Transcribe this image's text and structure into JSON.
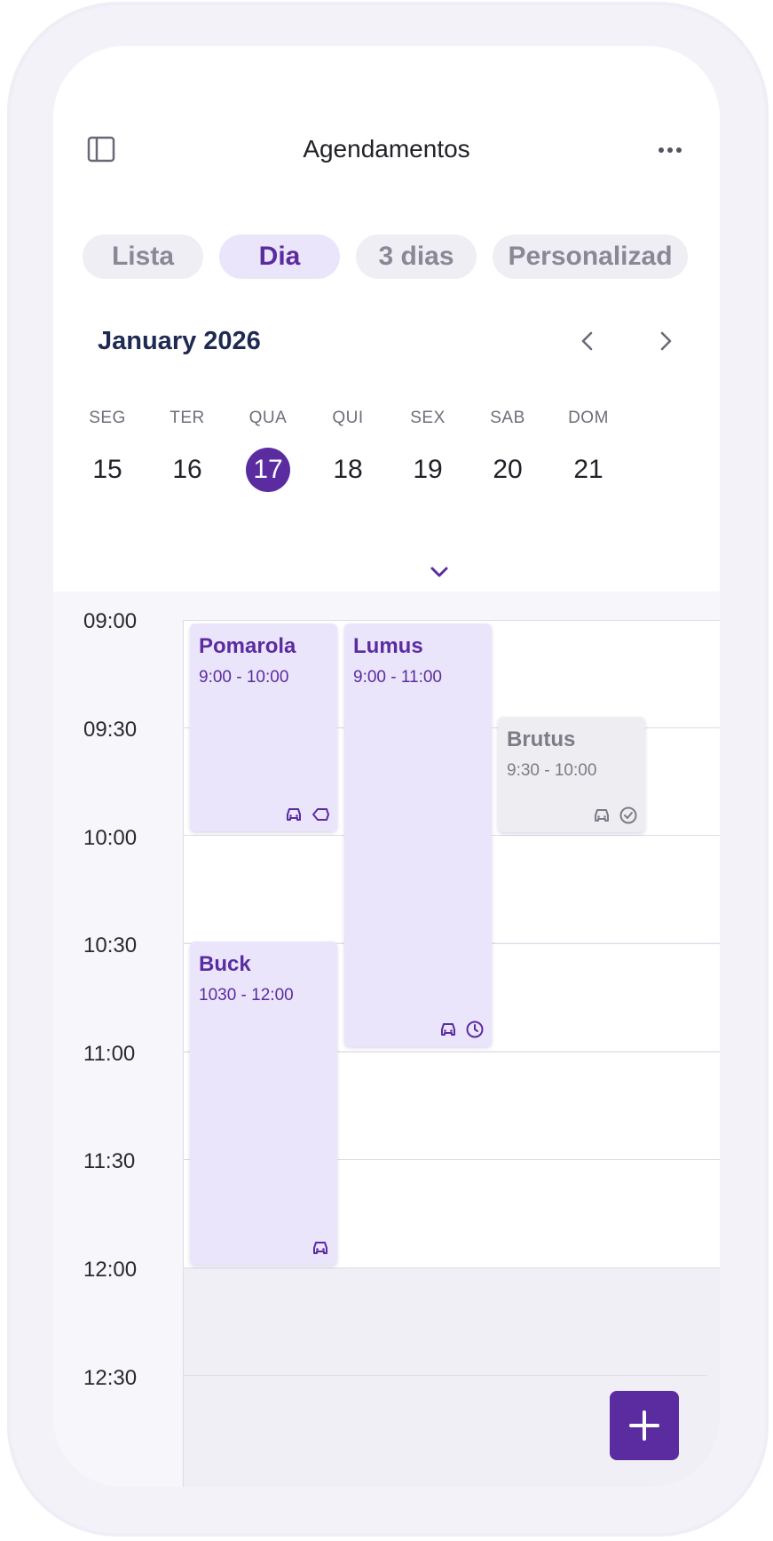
{
  "header": {
    "title": "Agendamentos",
    "sidebar_icon": "sidebar-toggle-icon",
    "more_icon": "more-horizontal-icon"
  },
  "tabs": [
    {
      "label": "Lista",
      "active": false
    },
    {
      "label": "Dia",
      "active": true
    },
    {
      "label": "3 dias",
      "active": false
    },
    {
      "label": "Personalizad",
      "active": false
    }
  ],
  "calendar": {
    "month_label": "January 2026",
    "prev_icon": "chevron-left-icon",
    "next_icon": "chevron-right-icon",
    "expand_icon": "chevron-down-icon",
    "days": [
      {
        "name": "SEG",
        "date": "15"
      },
      {
        "name": "TER",
        "date": "16"
      },
      {
        "name": "QUA",
        "date": "17",
        "selected": true
      },
      {
        "name": "QUI",
        "date": "18"
      },
      {
        "name": "SEX",
        "date": "19"
      },
      {
        "name": "SAB",
        "date": "20"
      },
      {
        "name": "DOM",
        "date": "21"
      }
    ]
  },
  "timeline": {
    "times": [
      "09:00",
      "09:30",
      "10:00",
      "10:30",
      "11:00",
      "11:30",
      "12:00",
      "12:30"
    ]
  },
  "events": [
    {
      "name": "Pomarola",
      "time": "9:00 - 10:00",
      "icons": [
        "car-icon",
        "tag-icon"
      ]
    },
    {
      "name": "Lumus",
      "time": "9:00 - 11:00",
      "icons": [
        "car-icon",
        "clock-icon"
      ]
    },
    {
      "name": "Brutus",
      "time": "9:30 - 10:00",
      "icons": [
        "car-icon",
        "check-circle-icon"
      ]
    },
    {
      "name": "Buck",
      "time": "1030 - 12:00",
      "icons": [
        "car-icon"
      ]
    }
  ],
  "colors": {
    "accent": "#5a2ca0",
    "event_bg": "#ebe5fb",
    "event_muted_bg": "#eeedf2"
  },
  "fab": {
    "icon": "plus-icon"
  }
}
